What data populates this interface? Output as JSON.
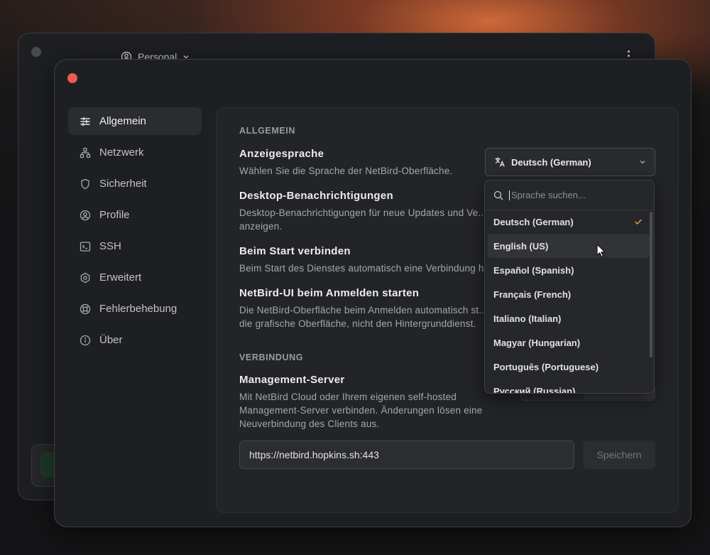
{
  "back_window": {
    "profile_label": "Personal"
  },
  "sidebar": {
    "items": [
      {
        "label": "Allgemein",
        "icon": "sliders-icon",
        "active": true
      },
      {
        "label": "Netzwerk",
        "icon": "network-icon",
        "active": false
      },
      {
        "label": "Sicherheit",
        "icon": "shield-icon",
        "active": false
      },
      {
        "label": "Profile",
        "icon": "user-circle-icon",
        "active": false
      },
      {
        "label": "SSH",
        "icon": "terminal-icon",
        "active": false
      },
      {
        "label": "Erweitert",
        "icon": "hexagon-gear-icon",
        "active": false
      },
      {
        "label": "Fehlerbehebung",
        "icon": "lifebuoy-icon",
        "active": false
      },
      {
        "label": "Über",
        "icon": "info-icon",
        "active": false
      }
    ]
  },
  "general": {
    "section_title": "ALLGEMEIN",
    "language": {
      "label": "Anzeigesprache",
      "desc": "Wählen Sie die Sprache der NetBird-Oberfläche.",
      "selected": "Deutsch (German)"
    },
    "notifications": {
      "label": "Desktop-Benachrichtigungen",
      "desc": "Desktop-Benachrichtigungen für neue Updates und Ve... anzeigen."
    },
    "connect_on_start": {
      "label": "Beim Start verbinden",
      "desc": "Beim Start des Dienstes automatisch eine Verbindung h..."
    },
    "ui_on_login": {
      "label": "NetBird-UI beim Anmelden starten",
      "desc": "Die NetBird-Oberfläche beim Anmelden automatisch st... die grafische Oberfläche, nicht den Hintergrunddienst."
    }
  },
  "connection": {
    "section_title": "VERBINDUNG",
    "management": {
      "label": "Management-Server",
      "desc": "Mit NetBird Cloud oder Ihrem eigenen self-hosted Management-Server verbinden. Änderungen lösen eine Neuverbindung des Clients aus.",
      "url_value": "https://netbird.hopkins.sh:443",
      "save_label": "Speichern"
    }
  },
  "dropdown": {
    "search_placeholder": "Sprache suchen...",
    "options": [
      {
        "label": "Deutsch (German)",
        "selected": true
      },
      {
        "label": "English (US)",
        "hovered": true
      },
      {
        "label": "Español (Spanish)"
      },
      {
        "label": "Français (French)"
      },
      {
        "label": "Italiano (Italian)"
      },
      {
        "label": "Magyar (Hungarian)"
      },
      {
        "label": "Português (Portuguese)"
      },
      {
        "label": "Русский (Russian)"
      }
    ]
  },
  "colors": {
    "accent_check": "#e2a24a",
    "close_button": "#ee5a52",
    "background_glow": "#d66c3a"
  }
}
